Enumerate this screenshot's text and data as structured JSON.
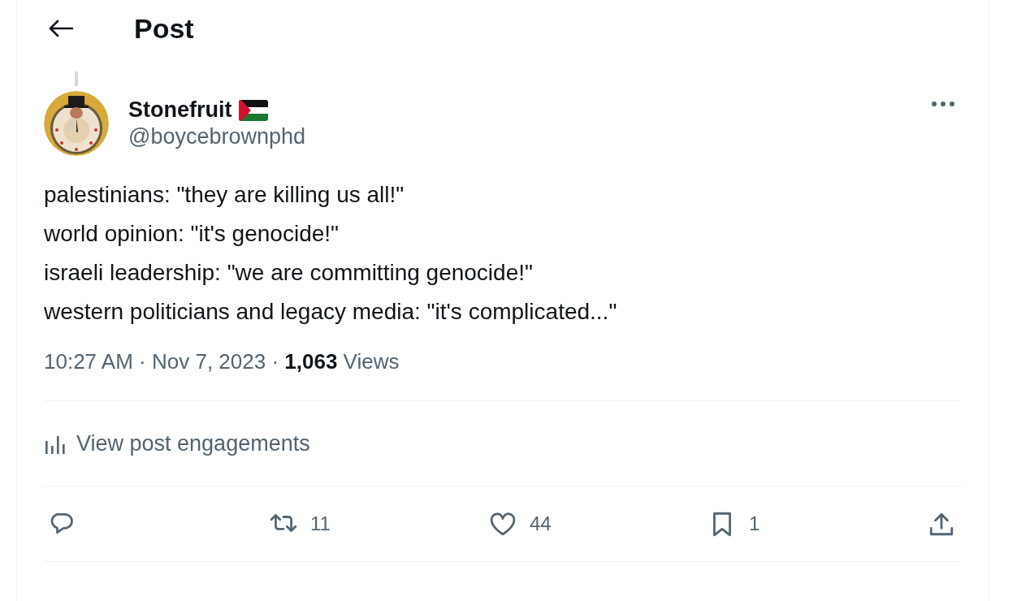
{
  "header": {
    "title": "Post"
  },
  "author": {
    "name": "Stonefruit",
    "handle": "@boycebrownphd"
  },
  "post": {
    "text": "palestinians: \"they are killing us all!\"\nworld opinion: \"it's genocide!\"\nisraeli leadership: \"we are committing genocide!\"\nwestern politicians and legacy media: \"it's complicated...\"",
    "meta": "10:27 AM · Nov 7, 2023 · **1,063** Views"
  },
  "engagements_link": "View post engagements",
  "actions": [
    {
      "kind": "reply"
    },
    {
      "kind": "repost",
      "count": "11"
    },
    {
      "kind": "like",
      "count": "44"
    },
    {
      "kind": "bookmark",
      "count": "1"
    },
    {
      "kind": "share"
    }
  ]
}
